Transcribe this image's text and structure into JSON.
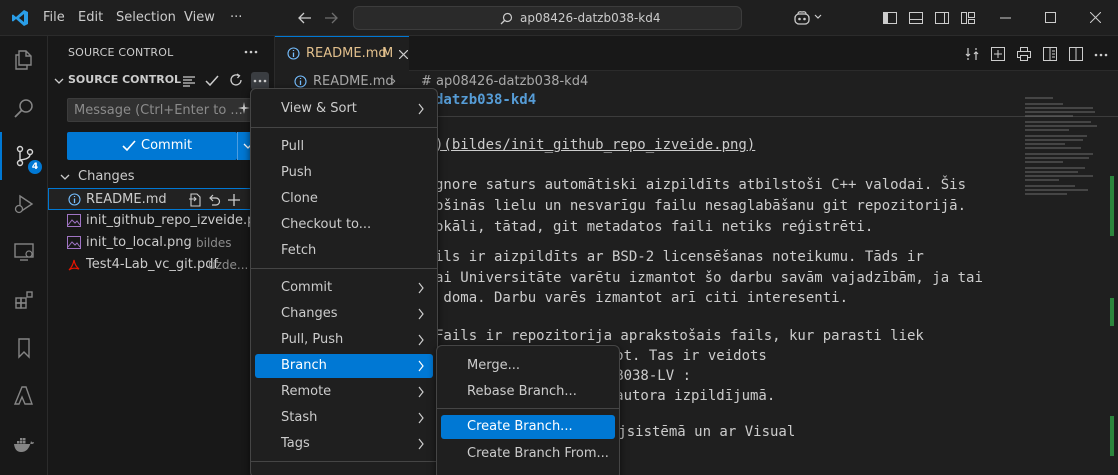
{
  "titlebar": {
    "menus": [
      "File",
      "Edit",
      "Selection",
      "View",
      "···"
    ],
    "command_center": "ap08426-datzb038-kd4"
  },
  "sidebar": {
    "view_title": "SOURCE CONTROL",
    "section_title": "SOURCE CONTROL",
    "message_placeholder": "Message (Ctrl+Enter to ...",
    "commit_label": "Commit",
    "changes_label": "Changes",
    "files": [
      {
        "name": "README.md",
        "desc": ""
      },
      {
        "name": "init_github_repo_izveide.p...",
        "desc": ""
      },
      {
        "name": "init_to_local.png",
        "desc": "bildes"
      },
      {
        "name": "Test4-Lab_vc_git.pdf",
        "desc": "uzde..."
      }
    ],
    "badge_count": "4"
  },
  "editor": {
    "tab_label": "README.md",
    "tab_status": "M",
    "breadcrumb_file": "README.md",
    "breadcrumb_symbol": "# ap08426-datzb038-kd4",
    "lines": [
      "datzb038-kd4",
      ")(bildes/init_github_repo_izveide.png)",
      "gnore saturs automātiski aizpildīts atbilstoši C++ valodai. Šis",
      "ošinās lielu un nesvarīgu failu nesaglabāšanu git repozitorijā.",
      "okāli, tātad, git metadatos faili netiks reģistrēti.",
      "ils ir aizpildīts ar BSD-2 licensēšanas noteikumu. Tāds ir",
      "ai Universitāte varētu izmantot šo darbu savām vajadzībām, ja tai",
      " doma. Darbu varēs izmantot arī citi interesenti.",
      "Fails ir repozitorija aprakstošais fails, kur parasti liek",
      "uru un kā to izmantot. Tas ir veidots",
      "umā, aprakstīs DatZB038-LV :",
      "pildi repozitorija autora izpildījumā.",
      "s Windwos operētājsistēmā un ar Visual"
    ]
  },
  "context_menu": {
    "items": [
      {
        "label": "View & Sort",
        "submenu": true
      },
      {
        "label": "Pull",
        "submenu": false
      },
      {
        "label": "Push",
        "submenu": false
      },
      {
        "label": "Clone",
        "submenu": false
      },
      {
        "label": "Checkout to...",
        "submenu": false
      },
      {
        "label": "Fetch",
        "submenu": false
      },
      {
        "label": "Commit",
        "submenu": true
      },
      {
        "label": "Changes",
        "submenu": true
      },
      {
        "label": "Pull, Push",
        "submenu": true
      },
      {
        "label": "Branch",
        "submenu": true
      },
      {
        "label": "Remote",
        "submenu": true
      },
      {
        "label": "Stash",
        "submenu": true
      },
      {
        "label": "Tags",
        "submenu": true
      }
    ]
  },
  "branch_submenu": {
    "items": [
      "Merge...",
      "Rebase Branch...",
      "Create Branch...",
      "Create Branch From..."
    ]
  },
  "colors": {
    "accent": "#0078d4",
    "modified": "#e2c08d",
    "pdf": "#e51400",
    "image": "#a074c4"
  }
}
